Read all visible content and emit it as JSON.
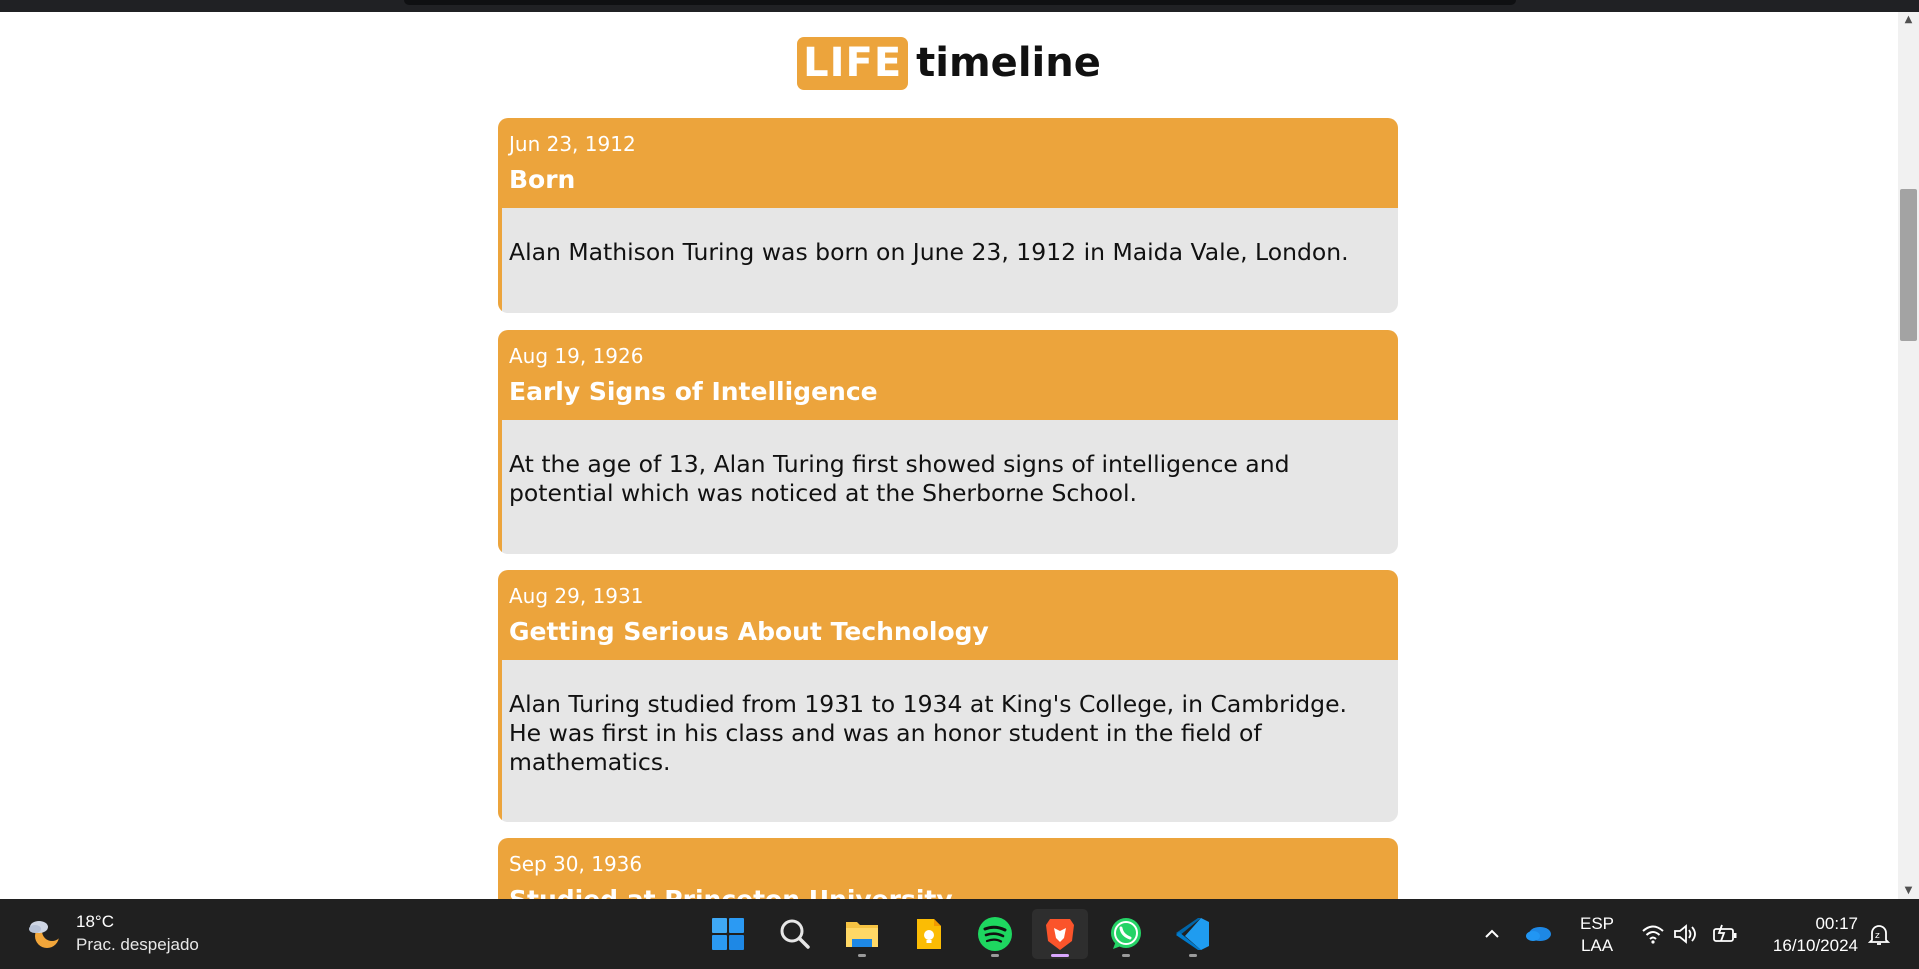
{
  "page": {
    "title_badge": "LIFE",
    "title_rest": "timeline"
  },
  "timeline": [
    {
      "date": "Jun 23, 1912",
      "event": "Born",
      "description": "Alan Mathison Turing was born on June 23, 1912 in Maida Vale, London."
    },
    {
      "date": "Aug 19, 1926",
      "event": "Early Signs of Intelligence",
      "description": "At the age of 13, Alan Turing first showed signs of intelligence and potential which was noticed at the Sherborne School."
    },
    {
      "date": "Aug 29, 1931",
      "event": "Getting Serious About Technology",
      "description": "Alan Turing studied from 1931 to 1934 at King's College, in Cambridge. He was first in his class and was an honor student in the field of mathematics."
    },
    {
      "date": "Sep 30, 1936",
      "event": "Studied at Princeton University"
    }
  ],
  "taskbar": {
    "weather": {
      "temp": "18°C",
      "desc": "Prac. despejado",
      "icon": "moon-cloud-icon"
    },
    "apps": [
      {
        "name": "start",
        "icon": "windows-icon"
      },
      {
        "name": "search",
        "icon": "search-icon"
      },
      {
        "name": "file-explorer",
        "icon": "folder-icon"
      },
      {
        "name": "keep",
        "icon": "note-icon"
      },
      {
        "name": "spotify",
        "icon": "spotify-icon"
      },
      {
        "name": "brave",
        "icon": "brave-icon"
      },
      {
        "name": "whatsapp",
        "icon": "whatsapp-icon"
      },
      {
        "name": "vscode",
        "icon": "vscode-icon"
      }
    ],
    "lang_top": "ESP",
    "lang_bottom": "LAA",
    "time": "00:17",
    "date": "16/10/2024"
  },
  "colors": {
    "accent": "#eca43c",
    "card_body": "#e6e6e6",
    "taskbar": "#202020"
  }
}
